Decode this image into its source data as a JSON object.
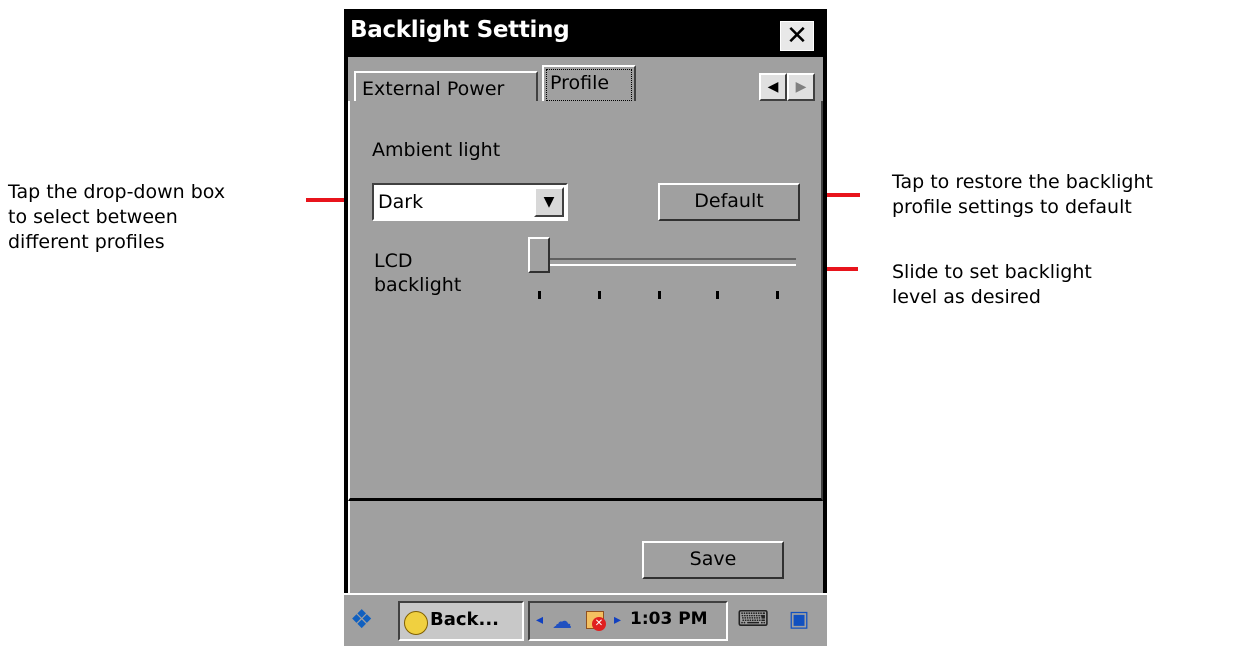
{
  "window": {
    "title": "Backlight Setting",
    "close_glyph": "✕"
  },
  "tabs": {
    "items": [
      {
        "label": "External Power"
      },
      {
        "label": "Profile"
      }
    ],
    "active": "Profile",
    "scroll_left_glyph": "◀",
    "scroll_right_glyph": "▶"
  },
  "profile": {
    "ambient_label": "Ambient light",
    "ambient_value": "Dark",
    "dropdown_glyph": "▼",
    "default_label": "Default",
    "lcd_label_line1": "LCD",
    "lcd_label_line2": "backlight",
    "slider_level": 0,
    "slider_ticks": 5
  },
  "bottom": {
    "save_label": "Save"
  },
  "taskbar": {
    "task_label": "Back...",
    "clock": "1:03 PM",
    "arrow_left": "◂",
    "arrow_right": "▸"
  },
  "annotations": {
    "left_line1": "Tap the drop-down box",
    "left_line2": "to select between",
    "left_line3": "different profiles",
    "right1_line1": "Tap to restore the backlight",
    "right1_line2": "profile settings to default",
    "right2_line1": "Slide to set backlight",
    "right2_line2": "level as desired"
  },
  "colors": {
    "callout_line": "#e8141c",
    "panel": "#a0a0a0",
    "titlebar": "#000000"
  }
}
